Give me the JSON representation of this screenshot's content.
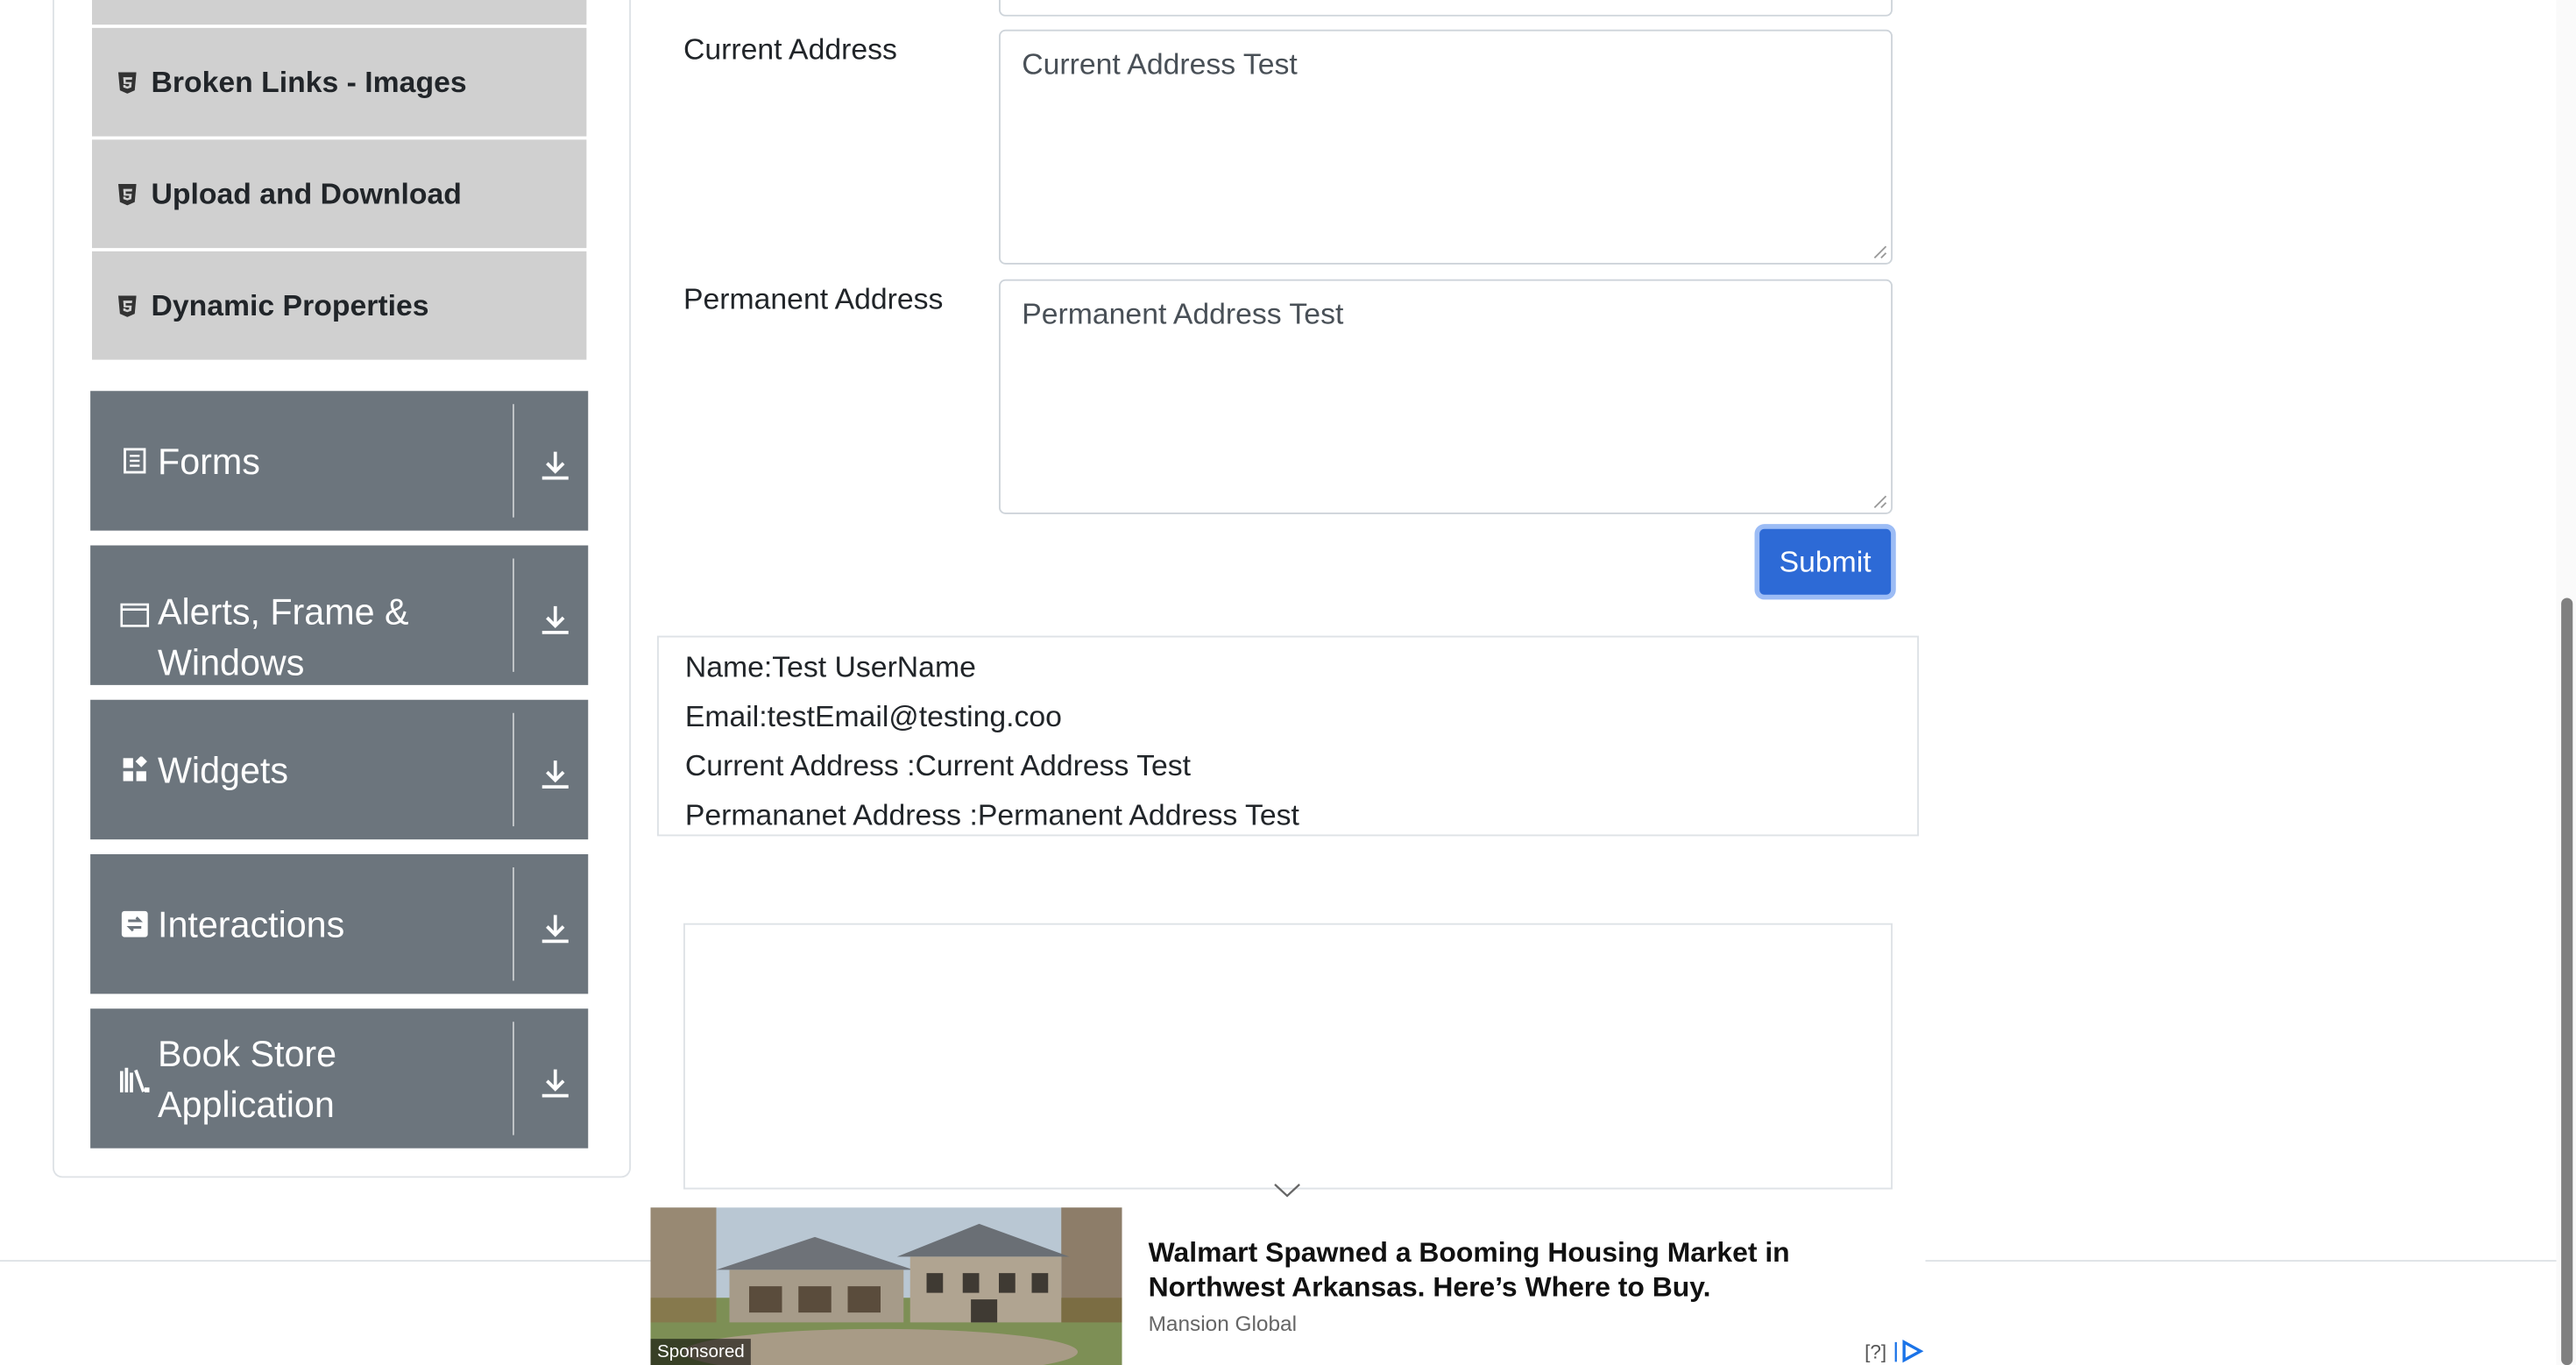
{
  "sidebar": {
    "sub_items": [
      {
        "label": "Broken Links - Images",
        "icon": "html5-icon"
      },
      {
        "label": "Upload and Download",
        "icon": "html5-icon"
      },
      {
        "label": "Dynamic Properties",
        "icon": "html5-icon"
      }
    ],
    "groups": [
      {
        "label": "Forms",
        "icon": "form-icon"
      },
      {
        "label": "Alerts, Frame & Windows",
        "icon": "window-icon"
      },
      {
        "label": "Widgets",
        "icon": "widgets-icon"
      },
      {
        "label": "Interactions",
        "icon": "interactions-icon"
      },
      {
        "label": "Book Store Application",
        "icon": "books-icon"
      }
    ]
  },
  "form": {
    "current_address_label": "Current Address",
    "current_address_value": "Current Address Test",
    "permanent_address_label": "Permanent Address",
    "permanent_address_value": "Permanent Address Test",
    "submit_label": "Submit"
  },
  "output": {
    "name": "Name:Test UserName",
    "email": "Email:testEmail@testing.coo",
    "current_address": "Current Address :Current Address Test",
    "permanent_address": "Permananet Address :Permanent Address Test"
  },
  "ad": {
    "sponsored": "Sponsored",
    "title": "Walmart Spawned a Booming Housing Market in Northwest Arkansas. Here’s Where to Buy.",
    "source": "Mansion Global",
    "help": "[?]"
  },
  "colors": {
    "sidebar_group": "#6c757d",
    "sidebar_sub": "#d0d0d0",
    "submit": "#2d6ad6"
  }
}
